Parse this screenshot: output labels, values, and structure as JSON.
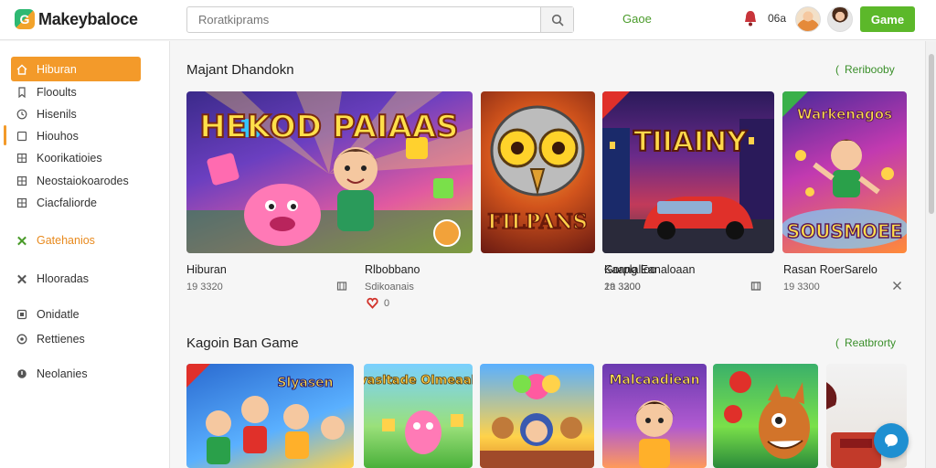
{
  "header": {
    "logo_text": "Makeybaloce",
    "search_placeholder": "Roratkiprams",
    "link_label": "Gaoe",
    "notification_count": "06a",
    "cta_label": "Game"
  },
  "sidebar": {
    "items": [
      {
        "label": "Hiburan",
        "icon": "home-icon",
        "active": true
      },
      {
        "label": "Flooults",
        "icon": "bookmark-icon"
      },
      {
        "label": "Hisenils",
        "icon": "clock-icon"
      },
      {
        "label": "Hiouhos",
        "icon": "square-icon"
      },
      {
        "label": "Koorikatioies",
        "icon": "grid-icon"
      },
      {
        "label": "Neostaiokoarodes",
        "icon": "grid-icon"
      },
      {
        "label": "Ciacfaliorde",
        "icon": "grid-icon"
      },
      {
        "label": "Gatehanios",
        "icon": "puzzle-icon"
      },
      {
        "label": "Hlooradas",
        "icon": "puzzle-icon"
      },
      {
        "label": "Onidatle",
        "icon": "square-icon"
      },
      {
        "label": "Rettienes",
        "icon": "circle-icon"
      },
      {
        "label": "Neolanies",
        "icon": "circle-icon"
      }
    ]
  },
  "section1": {
    "title": "Majant Dhandokn",
    "link": "Reribooby",
    "cards": [
      {
        "title": "Hiburan",
        "meta": "19 3320",
        "icon": "bookmark-icon",
        "art": "HEKOD PAIAAS",
        "rating": ""
      },
      {
        "title": "Rlbobbano",
        "meta": "Sdikoanais",
        "icon": "",
        "art": "FILPANS",
        "rating": "0"
      },
      {
        "title": "Gorplalloo",
        "meta": "19 3300",
        "icon": "",
        "art": "TIIAINY",
        "rating": ""
      },
      {
        "title": "Kaang Eanaloaan",
        "meta": "2a 3200",
        "icon": "bookmark-icon",
        "art": "",
        "rating": ""
      },
      {
        "title": "Rasan RoerSarelo",
        "meta": "19 3300",
        "icon": "close-icon",
        "art": "SOUSMOEE",
        "rating": ""
      }
    ]
  },
  "section2": {
    "title": "Kagoin Ban Game",
    "link": "Reatbrorty",
    "cards": [
      {
        "art": "Slyasen"
      },
      {
        "art": "Mvasltade Olmeaabe"
      },
      {
        "art": ""
      },
      {
        "art": "Malcaadiean"
      },
      {
        "art": ""
      },
      {
        "art": ""
      }
    ]
  },
  "colors": {
    "accent_orange": "#f39a2a",
    "accent_green": "#5cb82a",
    "fab_blue": "#1e8fd1"
  }
}
